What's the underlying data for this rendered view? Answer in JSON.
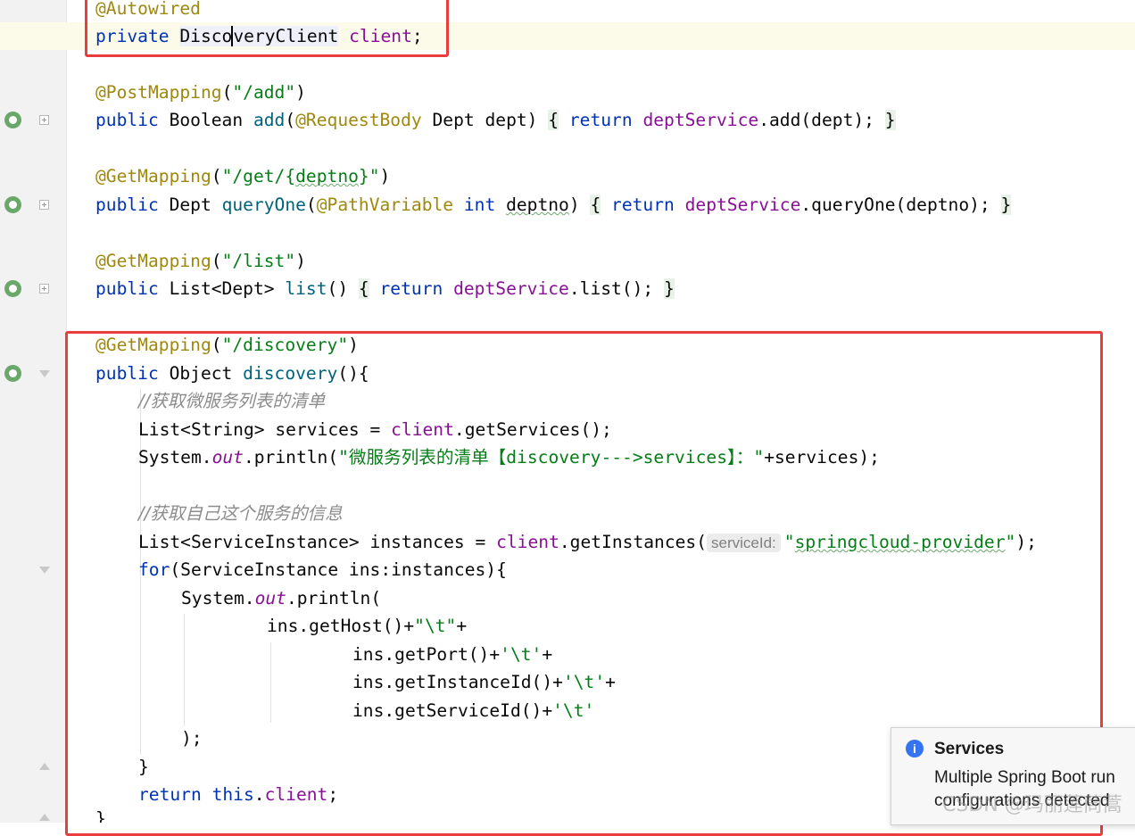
{
  "editor": {
    "lines": {
      "l1": {
        "ann": "@Autowired"
      },
      "l2": {
        "kw": "private",
        "sp1": " ",
        "type_a": "Disco",
        "type_b": "veryClient",
        "sp2": " ",
        "field": "client",
        "end": ";"
      },
      "l4": {
        "ann": "@PostMapping",
        "p1": "(",
        "str": "\"/add\"",
        "p2": ")"
      },
      "l5": {
        "kw": "public",
        "mid": " Boolean ",
        "fn": "add",
        "p1": "(",
        "ann": "@RequestBody",
        "rest": " Dept dept)",
        "sp": " ",
        "ob": "{",
        "sp2": " ",
        "ret": "return",
        "sp3": " ",
        "fld": "deptService",
        "call": ".add(dept);",
        "sp4": " ",
        "cb": "}"
      },
      "l7": {
        "ann": "@GetMapping",
        "p1": "(",
        "str_a": "\"/get/{",
        "str_b": "deptno",
        "str_c": "}\"",
        "p2": ")"
      },
      "l8": {
        "kw": "public",
        "mid": " Dept ",
        "fn": "queryOne",
        "p1": "(",
        "ann": "@PathVariable",
        "sp": " ",
        "kw2": "int",
        "sp2": " ",
        "param": "deptno",
        "p2": ")",
        "sp3": " ",
        "ob": "{",
        "sp4": " ",
        "ret": "return",
        "sp5": " ",
        "fld": "deptService",
        "call": ".queryOne(deptno);",
        "sp6": " ",
        "cb": "}"
      },
      "l10": {
        "ann": "@GetMapping",
        "p1": "(",
        "str": "\"/list\"",
        "p2": ")"
      },
      "l11": {
        "kw": "public",
        "mid": " List<Dept> ",
        "fn": "list",
        "p1": "()",
        "sp": " ",
        "ob": "{",
        "sp2": " ",
        "ret": "return",
        "sp3": " ",
        "fld": "deptService",
        "call": ".list();",
        "sp4": " ",
        "cb": "}"
      },
      "l13": {
        "ann": "@GetMapping",
        "p1": "(",
        "str": "\"/discovery\"",
        "p2": ")"
      },
      "l14": {
        "kw": "public",
        "mid": " Object ",
        "fn": "discovery",
        "rest": "(){"
      },
      "l15": {
        "cmt": "//获取微服务列表的清单"
      },
      "l16": {
        "a": "List<String> services = ",
        "fld": "client",
        "b": ".getServices();"
      },
      "l17": {
        "a": "System.",
        "st": "out",
        "b": ".println(",
        "str": "\"微服务列表的清单【discovery--->services】：\"",
        "c": "+services);"
      },
      "l19": {
        "cmt": "//获取自己这个服务的信息"
      },
      "l20": {
        "a": "List<ServiceInstance> instances = ",
        "fld": "client",
        "b": ".getInstances(",
        "hint": "serviceId:",
        "str_q1": "\"",
        "str_w": "springcloud-provider",
        "str_q2": "\"",
        "c": ");"
      },
      "l21": {
        "kw": "for",
        "a": "(ServiceInstance ins:instances){"
      },
      "l22": {
        "a": "System.",
        "st": "out",
        "b": ".println("
      },
      "l23": {
        "a": "ins.getHost()+",
        "str": "\"\\t\"",
        "b": "+"
      },
      "l24": {
        "a": "ins.getPort()+",
        "str": "'\\t'",
        "b": "+"
      },
      "l25": {
        "a": "ins.getInstanceId()+",
        "str": "'\\t'",
        "b": "+"
      },
      "l26": {
        "a": "ins.getServiceId()+",
        "str": "'\\t'"
      },
      "l27": {
        "a": ");"
      },
      "l28": {
        "a": "}"
      },
      "l29": {
        "kw": "return",
        "sp": " ",
        "kw2": "this",
        "a": ".",
        "fld": "client",
        "b": ";"
      },
      "l30": {
        "a": "}"
      }
    }
  },
  "notification": {
    "icon": "info-icon",
    "icon_glyph": "i",
    "title": "Services",
    "body": "Multiple Spring Boot run configurations detected"
  },
  "watermark": "CSDN @玛丽莲茼蒿",
  "colors": {
    "keyword": "#0033b3",
    "annotation": "#9e880d",
    "string": "#067d17",
    "method": "#00627a",
    "field": "#871094",
    "comment": "#8c8c8c",
    "highlight_box": "#ea3d3d",
    "current_line": "#fcfbea"
  }
}
